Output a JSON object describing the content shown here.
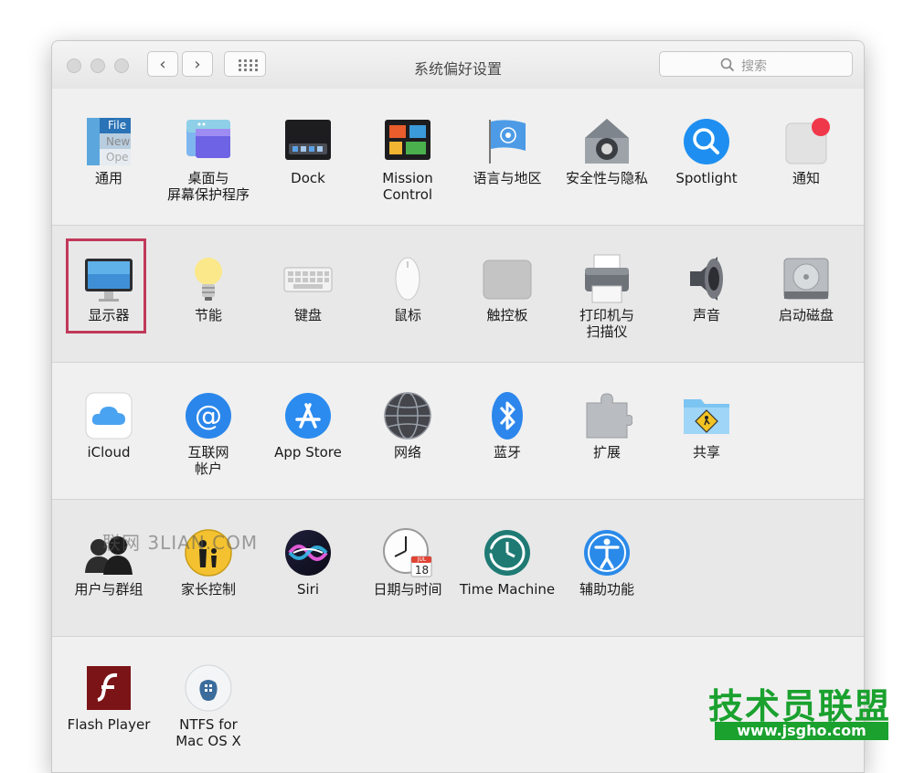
{
  "window": {
    "title": "系统偏好设置",
    "search_placeholder": "搜索",
    "back_label": "‹",
    "forward_label": "›"
  },
  "sections": [
    {
      "items": [
        {
          "id": "general",
          "label": "通用"
        },
        {
          "id": "desktop",
          "label": "桌面与\n屏幕保护程序"
        },
        {
          "id": "dock",
          "label": "Dock"
        },
        {
          "id": "mission",
          "label": "Mission\nControl"
        },
        {
          "id": "language",
          "label": "语言与地区"
        },
        {
          "id": "security",
          "label": "安全性与隐私"
        },
        {
          "id": "spotlight",
          "label": "Spotlight"
        },
        {
          "id": "notifications",
          "label": "通知"
        }
      ]
    },
    {
      "items": [
        {
          "id": "displays",
          "label": "显示器"
        },
        {
          "id": "energy",
          "label": "节能"
        },
        {
          "id": "keyboard",
          "label": "键盘"
        },
        {
          "id": "mouse",
          "label": "鼠标"
        },
        {
          "id": "trackpad",
          "label": "触控板"
        },
        {
          "id": "printers",
          "label": "打印机与\n扫描仪"
        },
        {
          "id": "sound",
          "label": "声音"
        },
        {
          "id": "startup",
          "label": "启动磁盘"
        }
      ]
    },
    {
      "items": [
        {
          "id": "icloud",
          "label": "iCloud"
        },
        {
          "id": "internet",
          "label": "互联网\n帐户"
        },
        {
          "id": "appstore",
          "label": "App Store"
        },
        {
          "id": "network",
          "label": "网络"
        },
        {
          "id": "bluetooth",
          "label": "蓝牙"
        },
        {
          "id": "extensions",
          "label": "扩展"
        },
        {
          "id": "sharing",
          "label": "共享"
        }
      ]
    },
    {
      "items": [
        {
          "id": "users",
          "label": "用户与群组"
        },
        {
          "id": "parental",
          "label": "家长控制"
        },
        {
          "id": "siri",
          "label": "Siri"
        },
        {
          "id": "datetime",
          "label": "日期与时间"
        },
        {
          "id": "timemachine",
          "label": "Time Machine"
        },
        {
          "id": "accessibility",
          "label": "辅助功能"
        }
      ]
    },
    {
      "items": [
        {
          "id": "flash",
          "label": "Flash Player"
        },
        {
          "id": "ntfs",
          "label": "NTFS for\nMac OS X"
        }
      ]
    }
  ],
  "calendar": {
    "month": "JUL",
    "day": "18"
  },
  "file_icon_text": {
    "file": "File",
    "new": "New",
    "open": "Ope"
  },
  "watermarks": {
    "center": "联网 3LIAN.COM",
    "brand": "技术员联盟",
    "url": "www.jsgho.com"
  },
  "colors": {
    "highlight": "#c0395a",
    "accent_blue": "#1e7ef0",
    "window_bg": "#ececec",
    "brand_green": "#1aa12e"
  }
}
